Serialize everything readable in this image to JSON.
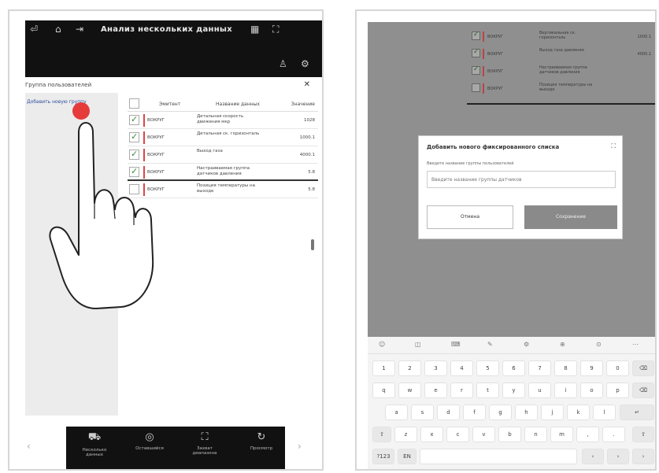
{
  "left": {
    "app_title": "Анализ нескольких данных",
    "panel_title": "Группа пользователей",
    "sidebar_link": "Добавить новую группу",
    "table": {
      "headers": [
        "Эмитент",
        "Название данных",
        "Значение"
      ],
      "rows": [
        {
          "checked": true,
          "code": "ВОКРУГ",
          "name": "Детальная скорость движения мкр",
          "value": "1028"
        },
        {
          "checked": true,
          "code": "ВОКРУГ",
          "name": "Детальная ск. горизонталь",
          "value": "1000.1"
        },
        {
          "checked": true,
          "code": "ВОКРУГ",
          "name": "Выход газа",
          "value": "4000.1"
        },
        {
          "checked": true,
          "code": "ВОКРУГ",
          "name": "Настраиваемая группа датчиков давления",
          "value": "5.8"
        },
        {
          "checked": false,
          "code": "ВОКРУГ",
          "name": "Позиция температуры на выходе",
          "value": "5.8"
        }
      ]
    },
    "bottom_bar": [
      {
        "icon": "truck-icon",
        "label": "Несколько данных"
      },
      {
        "icon": "target-icon",
        "label": "Оставшийся"
      },
      {
        "icon": "expand-icon",
        "label": "Захват диапазона"
      },
      {
        "icon": "refresh-icon",
        "label": "Просмотр"
      }
    ]
  },
  "right": {
    "bg_rows": [
      {
        "checked": true,
        "code": "ВОКРУГ",
        "name": "Вертикальная ск. горизонталь",
        "value": "1000.1"
      },
      {
        "checked": true,
        "code": "ВОКРУГ",
        "name": "Выход газа давления",
        "value": "4000.1"
      },
      {
        "checked": true,
        "code": "ВОКРУГ",
        "name": "Настраиваемая группа датчиков давления",
        "value": ""
      },
      {
        "checked": false,
        "code": "ВОКРУГ",
        "name": "Позиция температуры на выходе",
        "value": ""
      }
    ],
    "dialog": {
      "title": "Добавить нового фиксированного списка",
      "label": "Введите название группы пользователей",
      "placeholder": "Введите название группы датчиков",
      "cancel": "Отмена",
      "save": "Сохранение"
    },
    "keyboard": {
      "suggestions": [
        "☺",
        "◫",
        "⌨",
        "✎",
        "⚙",
        "⊕",
        "⊙",
        "⋯"
      ],
      "row1": [
        "1",
        "2",
        "3",
        "4",
        "5",
        "6",
        "7",
        "8",
        "9",
        "0"
      ],
      "row2": [
        "q",
        "w",
        "e",
        "r",
        "t",
        "y",
        "u",
        "i",
        "o",
        "p"
      ],
      "row3": [
        "a",
        "s",
        "d",
        "f",
        "g",
        "h",
        "j",
        "k",
        "l"
      ],
      "row4": [
        "z",
        "x",
        "c",
        "v",
        "b",
        "n",
        "m",
        ",",
        "."
      ],
      "del": "⌫",
      "enter": "↵",
      "shift": "⇧",
      "sym": "?123",
      "lang": "EN",
      "space": "",
      "left": "‹",
      "right": "›"
    }
  }
}
